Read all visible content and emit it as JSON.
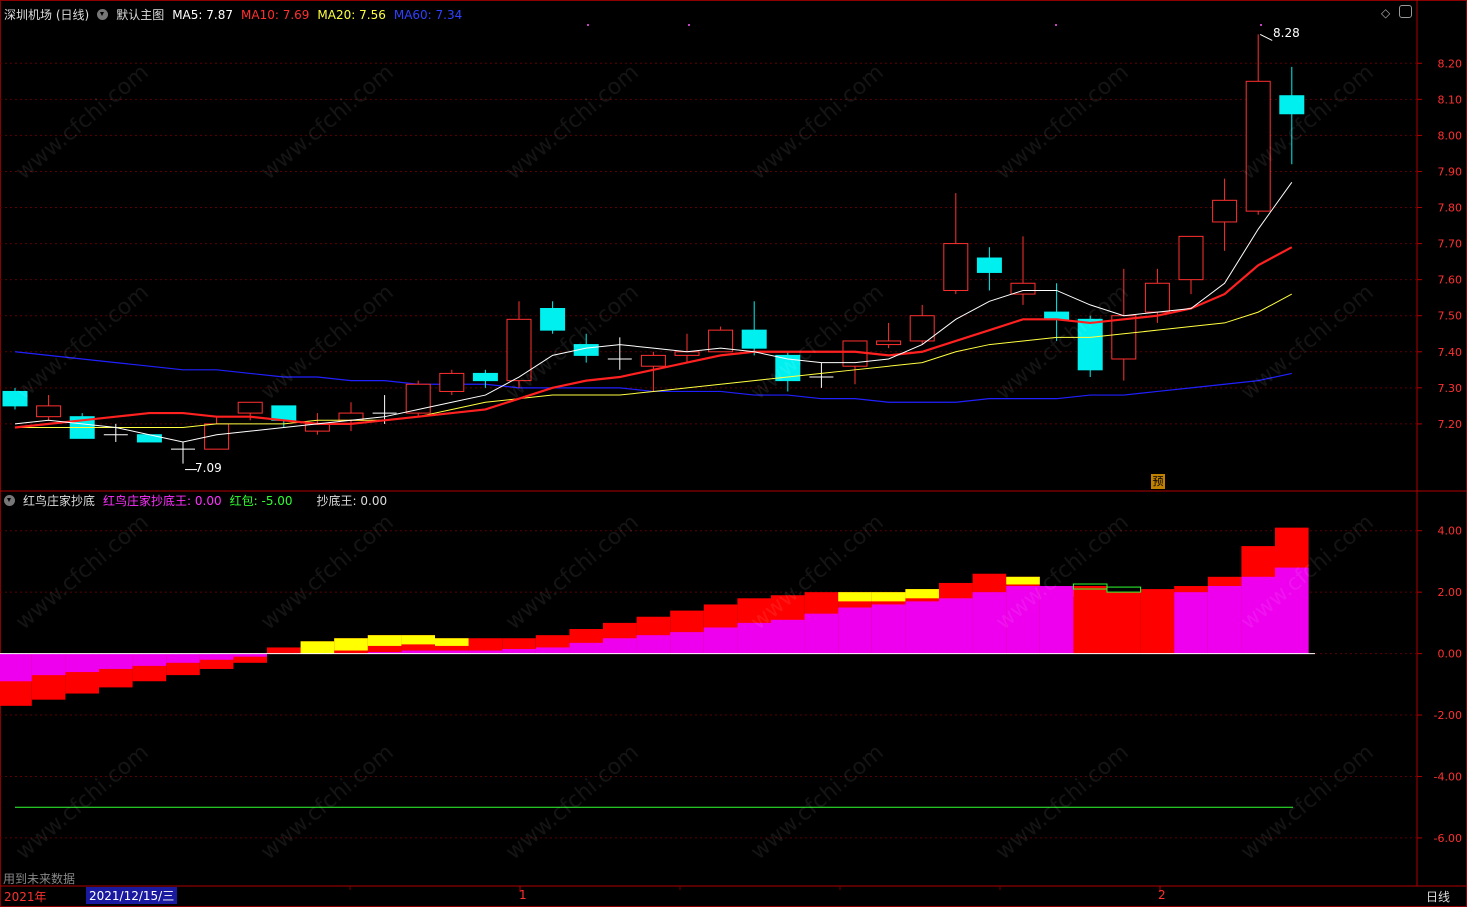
{
  "main_header": {
    "title": "深圳机场 (日线)",
    "template": "默认主图",
    "ma5_label": "MA5:",
    "ma5_value": "7.87",
    "ma10_label": "MA10:",
    "ma10_value": "7.69",
    "ma20_label": "MA20:",
    "ma20_value": "7.56",
    "ma60_label": "MA60:",
    "ma60_value": "7.34"
  },
  "sub_header": {
    "title": "红鸟庄家抄底",
    "hnzj_label": "红鸟庄家抄底王:",
    "hnzj_value": "0.00",
    "hb_label": "红包:",
    "hb_value": "-5.00",
    "cdw_label": "抄底王:",
    "cdw_value": "0.00"
  },
  "price_axis": [
    "8.20",
    "8.10",
    "8.00",
    "7.90",
    "7.80",
    "7.70",
    "7.60",
    "7.50",
    "7.40",
    "7.30",
    "7.20"
  ],
  "indicator_axis": [
    "4.00",
    "2.00",
    "0.00",
    "-2.00",
    "-4.00",
    "-6.00"
  ],
  "annotations": {
    "high": "8.28",
    "low": "7.09",
    "predict": "预"
  },
  "footer": {
    "future_data": "用到未来数据",
    "year": "2021年",
    "date_cursor": "2021/12/15/三",
    "month1": "1",
    "month2": "2",
    "period": "日线"
  },
  "watermark": "www.cfchi.com",
  "colors": {
    "ma5": "#ffffff",
    "ma10": "#ff2020",
    "ma20": "#ffff40",
    "ma60": "#2020ff",
    "up": "#ff3030",
    "down": "#00f0f0",
    "magenta": "#ff00ff",
    "yellow": "#ffff00",
    "green": "#30ff30"
  },
  "chart_data": {
    "type": "candlestick",
    "candles": [
      {
        "o": 7.29,
        "c": 7.25,
        "h": 7.3,
        "l": 7.24
      },
      {
        "o": 7.22,
        "c": 7.25,
        "h": 7.28,
        "l": 7.21
      },
      {
        "o": 7.22,
        "c": 7.16,
        "h": 7.23,
        "l": 7.16
      },
      {
        "o": 7.17,
        "c": 7.17,
        "h": 7.2,
        "l": 7.15
      },
      {
        "o": 7.17,
        "c": 7.15,
        "h": 7.17,
        "l": 7.15
      },
      {
        "o": 7.13,
        "c": 7.13,
        "h": 7.15,
        "l": 7.09
      },
      {
        "o": 7.13,
        "c": 7.2,
        "h": 7.22,
        "l": 7.13
      },
      {
        "o": 7.23,
        "c": 7.26,
        "h": 7.26,
        "l": 7.21
      },
      {
        "o": 7.25,
        "c": 7.21,
        "h": 7.25,
        "l": 7.19
      },
      {
        "o": 7.18,
        "c": 7.2,
        "h": 7.23,
        "l": 7.17
      },
      {
        "o": 7.21,
        "c": 7.23,
        "h": 7.26,
        "l": 7.18
      },
      {
        "o": 7.23,
        "c": 7.23,
        "h": 7.28,
        "l": 7.2
      },
      {
        "o": 7.23,
        "c": 7.31,
        "h": 7.32,
        "l": 7.22
      },
      {
        "o": 7.29,
        "c": 7.34,
        "h": 7.35,
        "l": 7.28
      },
      {
        "o": 7.34,
        "c": 7.32,
        "h": 7.35,
        "l": 7.3
      },
      {
        "o": 7.32,
        "c": 7.49,
        "h": 7.54,
        "l": 7.3
      },
      {
        "o": 7.52,
        "c": 7.46,
        "h": 7.54,
        "l": 7.45
      },
      {
        "o": 7.42,
        "c": 7.39,
        "h": 7.45,
        "l": 7.37
      },
      {
        "o": 7.38,
        "c": 7.38,
        "h": 7.44,
        "l": 7.35
      },
      {
        "o": 7.36,
        "c": 7.39,
        "h": 7.4,
        "l": 7.29
      },
      {
        "o": 7.39,
        "c": 7.4,
        "h": 7.45,
        "l": 7.37
      },
      {
        "o": 7.4,
        "c": 7.46,
        "h": 7.47,
        "l": 7.4
      },
      {
        "o": 7.46,
        "c": 7.41,
        "h": 7.54,
        "l": 7.39
      },
      {
        "o": 7.39,
        "c": 7.32,
        "h": 7.4,
        "l": 7.29
      },
      {
        "o": 7.33,
        "c": 7.33,
        "h": 7.37,
        "l": 7.3
      },
      {
        "o": 7.36,
        "c": 7.43,
        "h": 7.43,
        "l": 7.31
      },
      {
        "o": 7.42,
        "c": 7.43,
        "h": 7.48,
        "l": 7.41
      },
      {
        "o": 7.43,
        "c": 7.5,
        "h": 7.53,
        "l": 7.42
      },
      {
        "o": 7.57,
        "c": 7.7,
        "h": 7.84,
        "l": 7.56
      },
      {
        "o": 7.66,
        "c": 7.62,
        "h": 7.69,
        "l": 7.57
      },
      {
        "o": 7.56,
        "c": 7.59,
        "h": 7.72,
        "l": 7.53
      },
      {
        "o": 7.51,
        "c": 7.49,
        "h": 7.59,
        "l": 7.43
      },
      {
        "o": 7.49,
        "c": 7.35,
        "h": 7.5,
        "l": 7.33
      },
      {
        "o": 7.38,
        "c": 7.5,
        "h": 7.63,
        "l": 7.32
      },
      {
        "o": 7.51,
        "c": 7.59,
        "h": 7.63,
        "l": 7.48
      },
      {
        "o": 7.6,
        "c": 7.72,
        "h": 7.72,
        "l": 7.56
      },
      {
        "o": 7.76,
        "c": 7.82,
        "h": 7.88,
        "l": 7.68
      },
      {
        "o": 7.79,
        "c": 8.15,
        "h": 8.28,
        "l": 7.78
      },
      {
        "o": 8.11,
        "c": 8.06,
        "h": 8.19,
        "l": 7.92
      }
    ],
    "ma5": [
      7.2,
      7.21,
      7.2,
      7.19,
      7.17,
      7.15,
      7.17,
      7.18,
      7.19,
      7.2,
      7.21,
      7.22,
      7.24,
      7.26,
      7.28,
      7.33,
      7.39,
      7.41,
      7.42,
      7.41,
      7.4,
      7.41,
      7.4,
      7.38,
      7.37,
      7.37,
      7.38,
      7.42,
      7.49,
      7.54,
      7.57,
      7.57,
      7.53,
      7.5,
      7.51,
      7.52,
      7.59,
      7.74,
      7.87
    ],
    "ma10": [
      7.19,
      7.2,
      7.21,
      7.22,
      7.23,
      7.23,
      7.22,
      7.22,
      7.21,
      7.2,
      7.2,
      7.21,
      7.22,
      7.23,
      7.24,
      7.27,
      7.3,
      7.32,
      7.33,
      7.35,
      7.37,
      7.39,
      7.4,
      7.4,
      7.4,
      7.4,
      7.39,
      7.4,
      7.43,
      7.46,
      7.49,
      7.49,
      7.48,
      7.49,
      7.5,
      7.52,
      7.56,
      7.64,
      7.69
    ],
    "ma20": [
      7.19,
      7.19,
      7.19,
      7.19,
      7.19,
      7.19,
      7.2,
      7.2,
      7.2,
      7.21,
      7.21,
      7.21,
      7.22,
      7.24,
      7.26,
      7.27,
      7.28,
      7.28,
      7.28,
      7.29,
      7.3,
      7.31,
      7.32,
      7.33,
      7.34,
      7.35,
      7.36,
      7.37,
      7.4,
      7.42,
      7.43,
      7.44,
      7.44,
      7.45,
      7.46,
      7.47,
      7.48,
      7.51,
      7.56
    ],
    "ma60": [
      7.4,
      7.39,
      7.38,
      7.37,
      7.36,
      7.35,
      7.35,
      7.34,
      7.33,
      7.33,
      7.32,
      7.32,
      7.31,
      7.31,
      7.31,
      7.3,
      7.3,
      7.3,
      7.3,
      7.29,
      7.29,
      7.29,
      7.28,
      7.28,
      7.27,
      7.27,
      7.26,
      7.26,
      7.26,
      7.27,
      7.27,
      7.27,
      7.28,
      7.28,
      7.29,
      7.3,
      7.31,
      7.32,
      7.34
    ],
    "indicator": {
      "red_bars": [
        -1.7,
        -1.5,
        -1.3,
        -1.1,
        -0.9,
        -0.7,
        -0.5,
        -0.3,
        0.2,
        0.4,
        0.5,
        0.6,
        0.6,
        0.5,
        0.5,
        0.5,
        0.6,
        0.8,
        1.0,
        1.2,
        1.4,
        1.6,
        1.8,
        1.9,
        2.0,
        2.0,
        2.0,
        2.1,
        2.3,
        2.6,
        2.5,
        2.1,
        2.2,
        2.0,
        2.1,
        2.2,
        2.5,
        3.5,
        4.1
      ],
      "magenta_bars": [
        -0.9,
        -0.7,
        -0.6,
        -0.5,
        -0.4,
        -0.3,
        -0.2,
        -0.1,
        0.0,
        0.0,
        0.0,
        0.05,
        0.1,
        0.1,
        0.1,
        0.15,
        0.2,
        0.35,
        0.5,
        0.6,
        0.7,
        0.85,
        1.0,
        1.1,
        1.3,
        1.5,
        1.6,
        1.7,
        1.8,
        2.0,
        2.2,
        2.2,
        0.0,
        0.0,
        0.0,
        2.0,
        2.2,
        2.5,
        2.8
      ],
      "yellow_bars": [
        0,
        0,
        0,
        0,
        0,
        0,
        0,
        0,
        0,
        0.4,
        0.4,
        0.35,
        0.3,
        0.25,
        0,
        0,
        0,
        0,
        0,
        0,
        0,
        0,
        0,
        0,
        0,
        0.3,
        0.3,
        0.3,
        0,
        0,
        0.25,
        0.25,
        0,
        0,
        0,
        0,
        0,
        0,
        0
      ],
      "green_boxes": [
        0,
        0,
        0,
        0,
        0,
        0,
        0,
        0,
        0,
        0,
        0,
        0,
        0,
        0,
        0,
        0,
        0,
        0,
        0,
        0,
        0,
        0,
        0,
        0,
        0,
        0,
        0,
        0,
        0,
        0,
        0,
        0,
        2.2,
        2.1,
        0,
        0,
        0,
        0,
        0
      ],
      "hb_line": -5.0,
      "ylim": [
        -7.5,
        5.0
      ]
    },
    "ylim": [
      7.05,
      8.32
    ]
  }
}
